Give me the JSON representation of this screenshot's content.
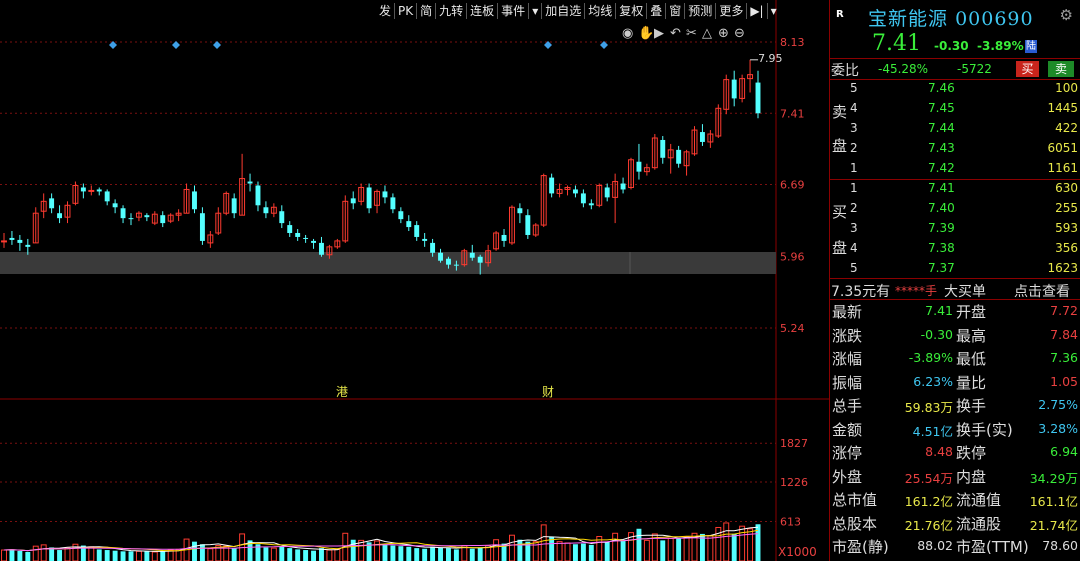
{
  "toolbar": {
    "items": [
      "发",
      "PK",
      "简",
      "九转",
      "连板",
      "事件",
      "▾",
      "加自选",
      "均线",
      "复权",
      "叠",
      "窗",
      "预测",
      "更多",
      "▶|",
      "▾"
    ]
  },
  "chart_data": {
    "type": "candlestick",
    "price_axis": {
      "ticks": [
        "8.13",
        "7.41",
        "6.69",
        "5.96",
        "5.24"
      ]
    },
    "volume_axis": {
      "ticks": [
        "1827",
        "1226",
        "613"
      ],
      "unit": "X1000"
    },
    "annotations": {
      "high_label": "7.95",
      "markers": [
        "港",
        "财"
      ]
    },
    "colors": {
      "up": "#ff3b30",
      "down": "#54ffff",
      "ma1": "#ffffff",
      "ma2": "#ffd700",
      "ma3": "#ff66ff",
      "grid": "#7a1010"
    },
    "candles": [
      [
        6.12,
        6.2,
        6.05,
        6.12
      ],
      [
        6.15,
        6.22,
        6.08,
        6.13
      ],
      [
        6.13,
        6.18,
        6.02,
        6.1
      ],
      [
        6.08,
        6.14,
        5.98,
        6.06
      ],
      [
        6.1,
        6.46,
        6.1,
        6.4
      ],
      [
        6.42,
        6.6,
        6.35,
        6.52
      ],
      [
        6.55,
        6.6,
        6.4,
        6.45
      ],
      [
        6.4,
        6.48,
        6.3,
        6.35
      ],
      [
        6.36,
        6.52,
        6.3,
        6.48
      ],
      [
        6.5,
        6.72,
        6.48,
        6.68
      ],
      [
        6.66,
        6.7,
        6.55,
        6.62
      ],
      [
        6.62,
        6.68,
        6.58,
        6.63
      ],
      [
        6.64,
        6.66,
        6.58,
        6.62
      ],
      [
        6.62,
        6.64,
        6.48,
        6.52
      ],
      [
        6.5,
        6.54,
        6.4,
        6.46
      ],
      [
        6.45,
        6.48,
        6.3,
        6.35
      ],
      [
        6.35,
        6.4,
        6.28,
        6.34
      ],
      [
        6.36,
        6.42,
        6.32,
        6.4
      ],
      [
        6.38,
        6.4,
        6.32,
        6.36
      ],
      [
        6.3,
        6.42,
        6.28,
        6.39
      ],
      [
        6.38,
        6.42,
        6.26,
        6.3
      ],
      [
        6.32,
        6.4,
        6.3,
        6.38
      ],
      [
        6.38,
        6.44,
        6.32,
        6.4
      ],
      [
        6.4,
        6.7,
        6.4,
        6.64
      ],
      [
        6.62,
        6.68,
        6.4,
        6.44
      ],
      [
        6.4,
        6.46,
        6.08,
        6.12
      ],
      [
        6.1,
        6.22,
        6.05,
        6.18
      ],
      [
        6.2,
        6.46,
        6.18,
        6.4
      ],
      [
        6.4,
        6.62,
        6.38,
        6.6
      ],
      [
        6.55,
        6.6,
        6.35,
        6.4
      ],
      [
        6.38,
        7.0,
        6.38,
        6.75
      ],
      [
        6.72,
        6.8,
        6.62,
        6.7
      ],
      [
        6.68,
        6.72,
        6.42,
        6.48
      ],
      [
        6.46,
        6.52,
        6.35,
        6.4
      ],
      [
        6.4,
        6.5,
        6.36,
        6.46
      ],
      [
        6.42,
        6.48,
        6.25,
        6.3
      ],
      [
        6.28,
        6.32,
        6.16,
        6.2
      ],
      [
        6.2,
        6.24,
        6.12,
        6.16
      ],
      [
        6.15,
        6.18,
        6.1,
        6.14
      ],
      [
        6.12,
        6.14,
        6.04,
        6.1
      ],
      [
        6.1,
        6.16,
        5.96,
        5.98
      ],
      [
        5.98,
        6.08,
        5.94,
        6.06
      ],
      [
        6.06,
        6.14,
        6.04,
        6.12
      ],
      [
        6.12,
        6.58,
        6.1,
        6.52
      ],
      [
        6.55,
        6.62,
        6.44,
        6.5
      ],
      [
        6.52,
        6.7,
        6.48,
        6.66
      ],
      [
        6.66,
        6.7,
        6.4,
        6.45
      ],
      [
        6.48,
        6.64,
        6.4,
        6.62
      ],
      [
        6.62,
        6.68,
        6.5,
        6.56
      ],
      [
        6.56,
        6.6,
        6.4,
        6.44
      ],
      [
        6.42,
        6.46,
        6.3,
        6.34
      ],
      [
        6.32,
        6.38,
        6.22,
        6.26
      ],
      [
        6.28,
        6.32,
        6.12,
        6.16
      ],
      [
        6.14,
        6.2,
        6.06,
        6.12
      ],
      [
        6.1,
        6.14,
        5.96,
        6.0
      ],
      [
        6.0,
        6.04,
        5.9,
        5.92
      ],
      [
        5.94,
        5.96,
        5.84,
        5.88
      ],
      [
        5.88,
        5.92,
        5.82,
        5.87
      ],
      [
        5.88,
        6.04,
        5.86,
        6.02
      ],
      [
        6.0,
        6.08,
        5.92,
        5.95
      ],
      [
        5.96,
        5.98,
        5.78,
        5.9
      ],
      [
        5.9,
        6.08,
        5.86,
        6.02
      ],
      [
        6.04,
        6.22,
        6.02,
        6.2
      ],
      [
        6.18,
        6.24,
        6.06,
        6.12
      ],
      [
        6.1,
        6.48,
        6.08,
        6.46
      ],
      [
        6.45,
        6.5,
        6.3,
        6.4
      ],
      [
        6.38,
        6.44,
        6.14,
        6.18
      ],
      [
        6.18,
        6.3,
        6.16,
        6.28
      ],
      [
        6.28,
        6.8,
        6.26,
        6.78
      ],
      [
        6.76,
        6.8,
        6.56,
        6.6
      ],
      [
        6.6,
        6.7,
        6.56,
        6.64
      ],
      [
        6.64,
        6.68,
        6.58,
        6.66
      ],
      [
        6.64,
        6.68,
        6.56,
        6.6
      ],
      [
        6.6,
        6.64,
        6.46,
        6.5
      ],
      [
        6.5,
        6.54,
        6.44,
        6.48
      ],
      [
        6.48,
        6.7,
        6.46,
        6.68
      ],
      [
        6.66,
        6.7,
        6.52,
        6.56
      ],
      [
        6.56,
        6.8,
        6.3,
        6.72
      ],
      [
        6.7,
        6.76,
        6.6,
        6.64
      ],
      [
        6.66,
        6.96,
        6.64,
        6.94
      ],
      [
        6.92,
        7.1,
        6.74,
        6.82
      ],
      [
        6.82,
        6.9,
        6.78,
        6.86
      ],
      [
        6.86,
        7.2,
        6.84,
        7.16
      ],
      [
        7.14,
        7.18,
        6.9,
        6.96
      ],
      [
        6.96,
        7.1,
        6.8,
        7.04
      ],
      [
        7.04,
        7.08,
        6.86,
        6.9
      ],
      [
        6.88,
        7.04,
        6.78,
        7.02
      ],
      [
        7.0,
        7.28,
        6.98,
        7.24
      ],
      [
        7.22,
        7.3,
        7.08,
        7.12
      ],
      [
        7.12,
        7.24,
        7.06,
        7.2
      ],
      [
        7.18,
        7.5,
        7.16,
        7.46
      ],
      [
        7.45,
        7.8,
        7.4,
        7.75
      ],
      [
        7.75,
        7.84,
        7.48,
        7.56
      ],
      [
        7.56,
        7.8,
        7.52,
        7.76
      ],
      [
        7.76,
        7.95,
        7.62,
        7.8
      ],
      [
        7.72,
        7.84,
        7.36,
        7.41
      ]
    ],
    "volumes": [
      170,
      180,
      155,
      140,
      230,
      250,
      210,
      170,
      200,
      260,
      240,
      220,
      180,
      170,
      160,
      150,
      150,
      150,
      155,
      140,
      150,
      170,
      180,
      340,
      300,
      260,
      190,
      240,
      230,
      200,
      420,
      320,
      260,
      210,
      200,
      230,
      200,
      180,
      170,
      160,
      200,
      170,
      180,
      430,
      330,
      320,
      290,
      310,
      260,
      240,
      230,
      220,
      200,
      190,
      220,
      210,
      200,
      180,
      240,
      190,
      210,
      240,
      330,
      270,
      400,
      330,
      300,
      300,
      560,
      380,
      300,
      280,
      260,
      270,
      250,
      380,
      300,
      430,
      310,
      440,
      500,
      320,
      420,
      320,
      350,
      360,
      380,
      430,
      420,
      390,
      520,
      590,
      420,
      540,
      500,
      570
    ]
  },
  "quote": {
    "market_mark": "R",
    "name": "宝新能源",
    "code": "000690",
    "price": "7.41",
    "change": "-0.30",
    "change_pct": "-3.89%",
    "tag": "陆",
    "weibi_label": "委比",
    "weibi": "-45.28%",
    "weicha": "-5722",
    "buy_btn": "买",
    "sell_btn": "卖",
    "sell_label": [
      "卖",
      "盘"
    ],
    "buy_label": [
      "买",
      "盘"
    ],
    "sell_rows": [
      {
        "lv": "5",
        "p": "7.46",
        "v": "100"
      },
      {
        "lv": "4",
        "p": "7.45",
        "v": "1445"
      },
      {
        "lv": "3",
        "p": "7.44",
        "v": "422"
      },
      {
        "lv": "2",
        "p": "7.43",
        "v": "6051"
      },
      {
        "lv": "1",
        "p": "7.42",
        "v": "1161"
      }
    ],
    "buy_rows": [
      {
        "lv": "1",
        "p": "7.41",
        "v": "630"
      },
      {
        "lv": "2",
        "p": "7.40",
        "v": "255"
      },
      {
        "lv": "3",
        "p": "7.39",
        "v": "593"
      },
      {
        "lv": "4",
        "p": "7.38",
        "v": "356"
      },
      {
        "lv": "5",
        "p": "7.37",
        "v": "1623"
      }
    ],
    "big_order": {
      "prefix": "7.35元有",
      "stars": "*****手",
      "label": "大买单",
      "link": "点击查看"
    },
    "stats": [
      {
        "l1": "最新",
        "v1": "7.41",
        "c1": "#3aee3a",
        "l2": "开盘",
        "v2": "7.72",
        "c2": "#e84040"
      },
      {
        "l1": "涨跌",
        "v1": "-0.30",
        "c1": "#3aee3a",
        "l2": "最高",
        "v2": "7.84",
        "c2": "#e84040"
      },
      {
        "l1": "涨幅",
        "v1": "-3.89%",
        "c1": "#3aee3a",
        "l2": "最低",
        "v2": "7.36",
        "c2": "#3aee3a"
      },
      {
        "l1": "振幅",
        "v1": "6.23%",
        "c1": "#3fc6f0",
        "l2": "量比",
        "v2": "1.05",
        "c2": "#e84040"
      },
      {
        "l1": "总手",
        "v1": "59.83万",
        "c1": "#e8e84a",
        "l2": "换手",
        "v2": "2.75%",
        "c2": "#3fc6f0"
      },
      {
        "l1": "金额",
        "v1": "4.51亿",
        "c1": "#3fc6f0",
        "l2": "换手(实)",
        "v2": "3.28%",
        "c2": "#3fc6f0"
      },
      {
        "l1": "涨停",
        "v1": "8.48",
        "c1": "#e84040",
        "l2": "跌停",
        "v2": "6.94",
        "c2": "#3aee3a"
      },
      {
        "l1": "外盘",
        "v1": "25.54万",
        "c1": "#e84040",
        "l2": "内盘",
        "v2": "34.29万",
        "c2": "#3aee3a"
      },
      {
        "l1": "总市值",
        "v1": "161.2亿",
        "c1": "#e8e84a",
        "l2": "流通值",
        "v2": "161.1亿",
        "c2": "#e8e84a"
      },
      {
        "l1": "总股本",
        "v1": "21.76亿",
        "c1": "#e8e84a",
        "l2": "流通股",
        "v2": "21.74亿",
        "c2": "#e8e84a"
      },
      {
        "l1": "市盈(静)",
        "v1": "88.02",
        "c1": "#ddd",
        "l2": "市盈(TTM)",
        "v2": "78.60",
        "c2": "#ddd"
      }
    ]
  }
}
